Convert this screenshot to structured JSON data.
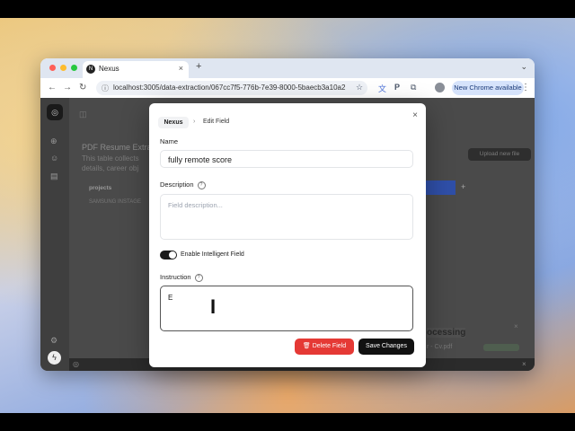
{
  "browser": {
    "tab_title": "Nexus",
    "url": "localhost:3005/data-extraction/067cc7f5-776b-7e39-8000-5baecb3a10a2",
    "update_button": "New Chrome available",
    "new_tab": "+",
    "tab_close": "×"
  },
  "background": {
    "page_title": "PDF Resume Extrac",
    "page_desc_1": "This table collects",
    "page_desc_2": "details, career obj",
    "upload_button": "Upload new file",
    "table_header": "projects",
    "table_cell": "SAMSUNG INSTAGE",
    "processing": "ocessing",
    "processing_file": "r - Cv.pdf"
  },
  "modal": {
    "breadcrumb_root": "Nexus",
    "breadcrumb_sep": "›",
    "breadcrumb_current": "Edit Field",
    "close": "×",
    "name_label": "Name",
    "name_value": "fully remote score",
    "description_label": "Description",
    "description_placeholder": "Field description...",
    "toggle_label": "Enable Intelligent Field",
    "instruction_label": "Instruction",
    "instruction_value": "E",
    "delete_button": "Delete Field",
    "save_button": "Save Changes"
  }
}
